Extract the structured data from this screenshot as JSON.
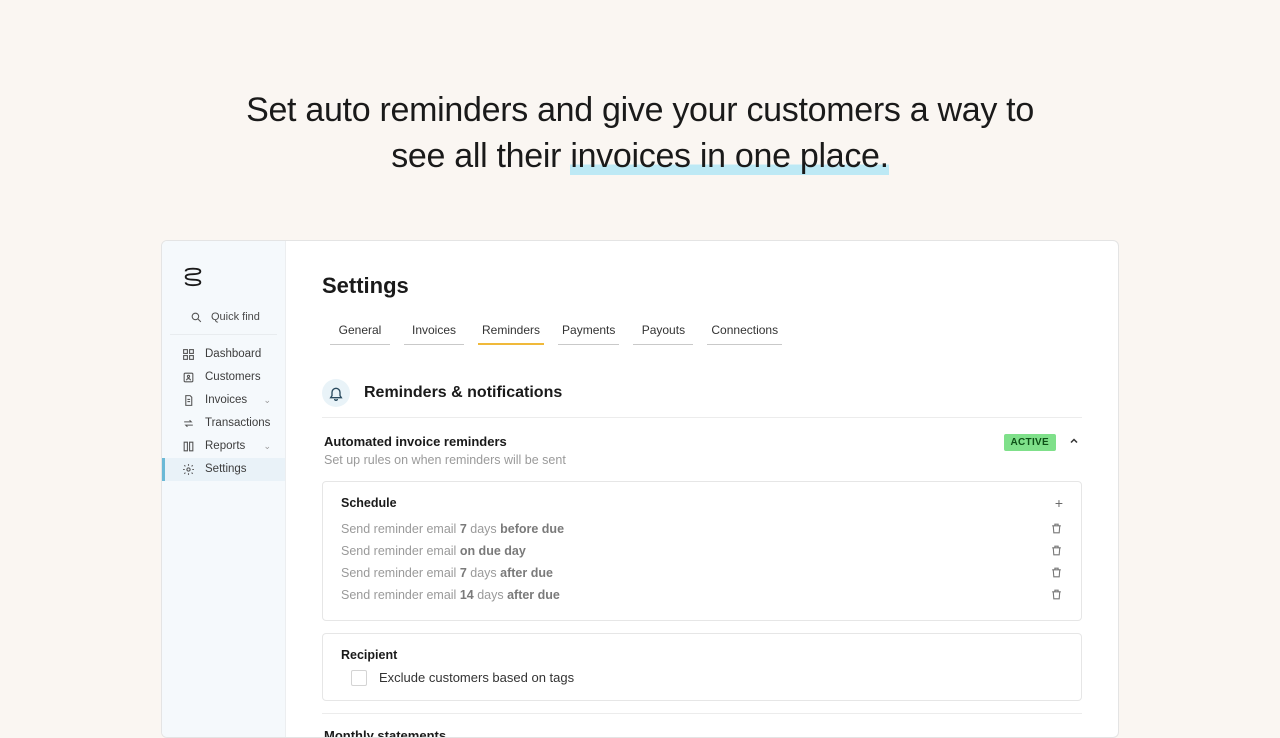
{
  "hero": {
    "line1": "Set auto reminders and give your customers a way to",
    "line2_a": "see all their ",
    "line2_b": "invoices in one place."
  },
  "sidebar": {
    "quickfind": "Quick find",
    "items": [
      {
        "id": "dashboard",
        "label": "Dashboard",
        "expandable": false
      },
      {
        "id": "customers",
        "label": "Customers",
        "expandable": false
      },
      {
        "id": "invoices",
        "label": "Invoices",
        "expandable": true
      },
      {
        "id": "transactions",
        "label": "Transactions",
        "expandable": false
      },
      {
        "id": "reports",
        "label": "Reports",
        "expandable": true
      },
      {
        "id": "settings",
        "label": "Settings",
        "expandable": false,
        "active": true
      }
    ]
  },
  "page": {
    "title": "Settings",
    "tabs": [
      "General",
      "Invoices",
      "Reminders",
      "Payments",
      "Payouts",
      "Connections"
    ],
    "active_tab": "Reminders"
  },
  "section": {
    "title": "Reminders & notifications",
    "auto": {
      "title": "Automated invoice reminders",
      "desc": "Set up rules on when reminders will be sent",
      "badge": "ACTIVE"
    },
    "schedule": {
      "title": "Schedule",
      "rules": [
        {
          "prefix": "Send reminder email ",
          "n": "7",
          "mid": " days ",
          "suffix": "before due"
        },
        {
          "prefix": "Send reminder email ",
          "n": "",
          "mid": "",
          "suffix": "on due day"
        },
        {
          "prefix": "Send reminder email ",
          "n": "7",
          "mid": " days ",
          "suffix": "after due"
        },
        {
          "prefix": "Send reminder email ",
          "n": "14",
          "mid": " days ",
          "suffix": "after due"
        }
      ]
    },
    "recipient": {
      "title": "Recipient",
      "checkbox_label": "Exclude customers based on tags"
    },
    "monthly": "Monthly statements"
  }
}
